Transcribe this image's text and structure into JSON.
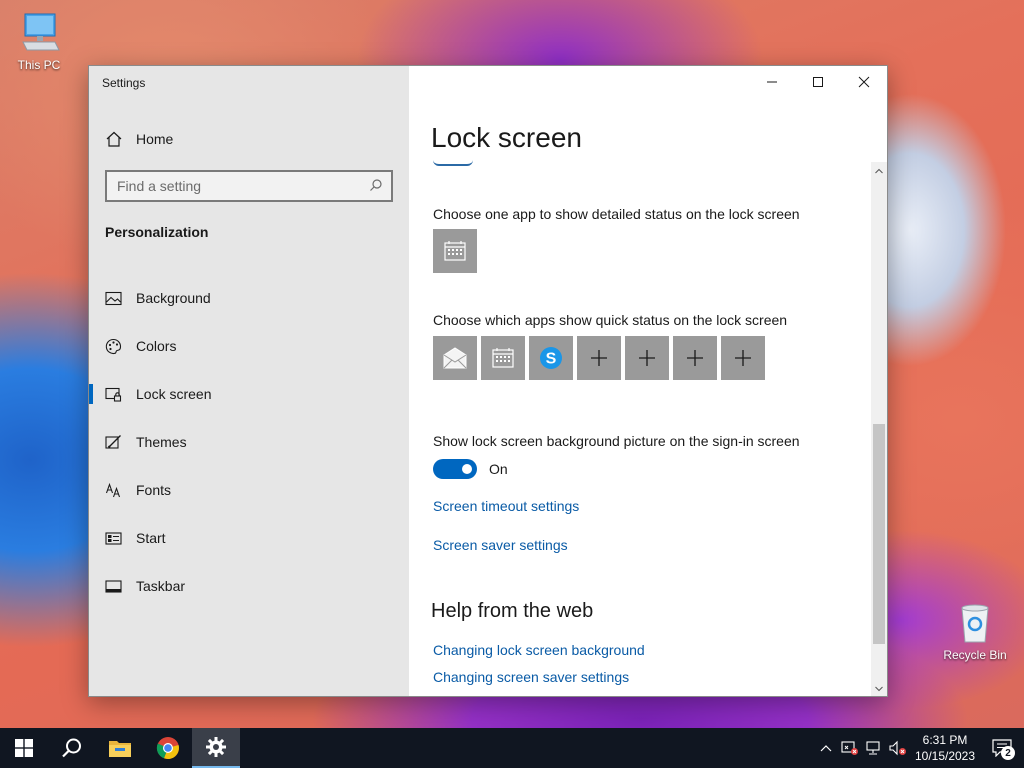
{
  "desktop": {
    "icons": [
      {
        "label": "This PC",
        "icon": "this-pc-icon"
      },
      {
        "label": "Recycle Bin",
        "icon": "recycle-bin-icon"
      }
    ]
  },
  "window": {
    "title": "Settings",
    "caption_buttons": [
      "minimize-icon",
      "maximize-icon",
      "close-icon"
    ]
  },
  "sidebar": {
    "home_label": "Home",
    "search_placeholder": "Find a setting",
    "section_heading": "Personalization",
    "items": [
      {
        "label": "Background",
        "icon": "background-icon",
        "active": false
      },
      {
        "label": "Colors",
        "icon": "colors-icon",
        "active": false
      },
      {
        "label": "Lock screen",
        "icon": "lock-screen-icon",
        "active": true
      },
      {
        "label": "Themes",
        "icon": "themes-icon",
        "active": false
      },
      {
        "label": "Fonts",
        "icon": "fonts-icon",
        "active": false
      },
      {
        "label": "Start",
        "icon": "start-icon",
        "active": false
      },
      {
        "label": "Taskbar",
        "icon": "taskbar-icon",
        "active": false
      }
    ]
  },
  "main": {
    "page_title": "Lock screen",
    "detailed_status_label": "Choose one app to show detailed status on the lock screen",
    "detailed_status_app": "calendar-icon",
    "quick_status_label": "Choose which apps show quick status on the lock screen",
    "quick_status_apps": [
      "mail-icon",
      "calendar-icon",
      "skype-icon",
      "add-icon",
      "add-icon",
      "add-icon",
      "add-icon"
    ],
    "signin_bg_label": "Show lock screen background picture on the sign-in screen",
    "signin_bg_toggle": {
      "state": "On",
      "on": true
    },
    "links": [
      "Screen timeout settings",
      "Screen saver settings"
    ],
    "help_heading": "Help from the web",
    "help_links": [
      "Changing lock screen background",
      "Changing screen saver settings"
    ]
  },
  "colors": {
    "accent": "#0067c0",
    "link": "#0a5ba6",
    "sidebar_bg": "#e6e6e6",
    "tile_bg": "#9a9a9a",
    "taskbar_bg": "#101621"
  },
  "taskbar": {
    "pinned": [
      "start-icon",
      "search-icon",
      "file-explorer-icon",
      "chrome-icon",
      "settings-icon"
    ],
    "tray": [
      "chevron-up-icon",
      "security-warning-icon",
      "network-icon",
      "volume-muted-icon"
    ],
    "time": "6:31 PM",
    "date": "10/15/2023",
    "notification_count": "2"
  }
}
